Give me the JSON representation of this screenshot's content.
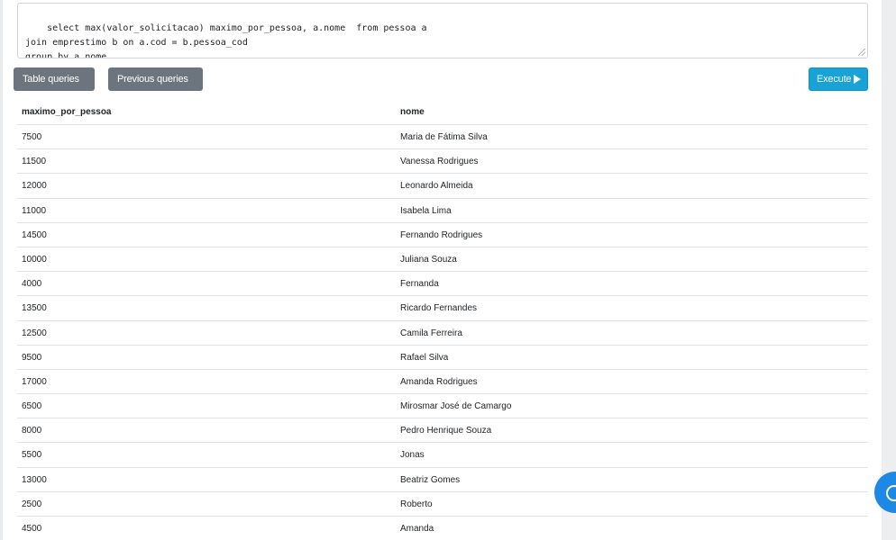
{
  "editor": {
    "query": "select max(valor_solicitacao) maximo_por_pessoa, a.nome  from pessoa a\njoin emprestimo b on a.cod = b.pessoa_cod\ngroup by a.nome"
  },
  "toolbar": {
    "table_queries_label": "Table queries",
    "previous_queries_label": "Previous queries",
    "execute_label": "Execute",
    "execute_color": "#17a2d8",
    "dropdown_color": "#6c757d"
  },
  "results": {
    "columns": [
      "maximo_por_pessoa",
      "nome"
    ],
    "rows": [
      [
        "7500",
        "Maria de Fátima Silva"
      ],
      [
        "11500",
        "Vanessa Rodrigues"
      ],
      [
        "12000",
        "Leonardo Almeida"
      ],
      [
        "11000",
        "Isabela Lima"
      ],
      [
        "14500",
        "Fernando Rodrigues"
      ],
      [
        "10000",
        "Juliana Souza"
      ],
      [
        "4000",
        "Fernanda"
      ],
      [
        "13500",
        "Ricardo Fernandes"
      ],
      [
        "12500",
        "Camila Ferreira"
      ],
      [
        "9500",
        "Rafael Silva"
      ],
      [
        "17000",
        "Amanda Rodrigues"
      ],
      [
        "6500",
        "Mirosmar José de Camargo"
      ],
      [
        "8000",
        "Pedro Henrique Souza"
      ],
      [
        "5500",
        "Jonas"
      ],
      [
        "13000",
        "Beatriz Gomes"
      ],
      [
        "2500",
        "Roberto"
      ],
      [
        "4500",
        "Amanda"
      ]
    ]
  },
  "icons": {
    "dropdown": "caret-down-icon",
    "execute": "play-icon",
    "chat": "chat-bubble-icon"
  }
}
